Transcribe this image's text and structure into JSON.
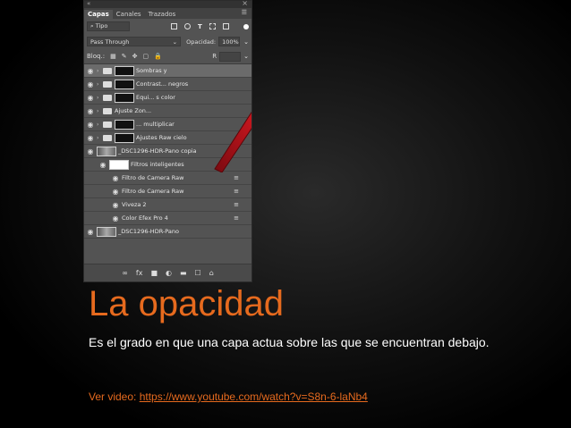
{
  "panel": {
    "tabs": [
      "Capas",
      "Canales",
      "Trazados"
    ],
    "filter_label": "⌕ Tipo",
    "blend_mode": "Pass Through",
    "opacity_label": "Opacidad:",
    "opacity_value": "100%",
    "lock_label": "Bloq.:",
    "fill_label": "R",
    "layers": [
      {
        "name": "Sombras y",
        "type": "group",
        "thumb": "mask",
        "selected": true
      },
      {
        "name": "Contrast... negros",
        "type": "group",
        "thumb": "mask",
        "selected": false
      },
      {
        "name": "Equi... s color",
        "type": "group",
        "thumb": "mask",
        "selected": false
      },
      {
        "name": "Ajuste Zon...",
        "type": "group",
        "thumb": "none",
        "selected": false
      },
      {
        "name": "... multiplicar",
        "type": "group",
        "thumb": "mask",
        "selected": false
      },
      {
        "name": "Ajustes Raw cielo",
        "type": "group",
        "thumb": "mask",
        "selected": false
      },
      {
        "name": "_DSC1296-HDR-Pano copia",
        "type": "smart",
        "thumb": "photo",
        "selected": false
      },
      {
        "name": "Filtros inteligentes",
        "type": "filters",
        "thumb": "white",
        "selected": false
      },
      {
        "name": "Filtro de Camera Raw",
        "type": "filter",
        "thumb": "none",
        "selected": false
      },
      {
        "name": "Filtro de Camera Raw",
        "type": "filter",
        "thumb": "none",
        "selected": false
      },
      {
        "name": "Viveza 2",
        "type": "filter",
        "thumb": "none",
        "selected": false
      },
      {
        "name": "Color Efex Pro 4",
        "type": "filter",
        "thumb": "none",
        "selected": false
      },
      {
        "name": "_DSC1296-HDR-Pano",
        "type": "photo",
        "thumb": "photo",
        "selected": false
      }
    ],
    "bottom_icons": [
      "∞",
      "fx",
      "■",
      "◐",
      "▬",
      "☐",
      "⌂"
    ]
  },
  "slide": {
    "title": "La opacidad",
    "description": "Es el grado en que una capa actua sobre las que se encuentran debajo.",
    "video_label": "Ver video:",
    "video_link": "https://www.youtube.com/watch?v=S8n-6-laNb4"
  },
  "colors": {
    "accent": "#e66a1e",
    "arrow": "#c0141c"
  }
}
